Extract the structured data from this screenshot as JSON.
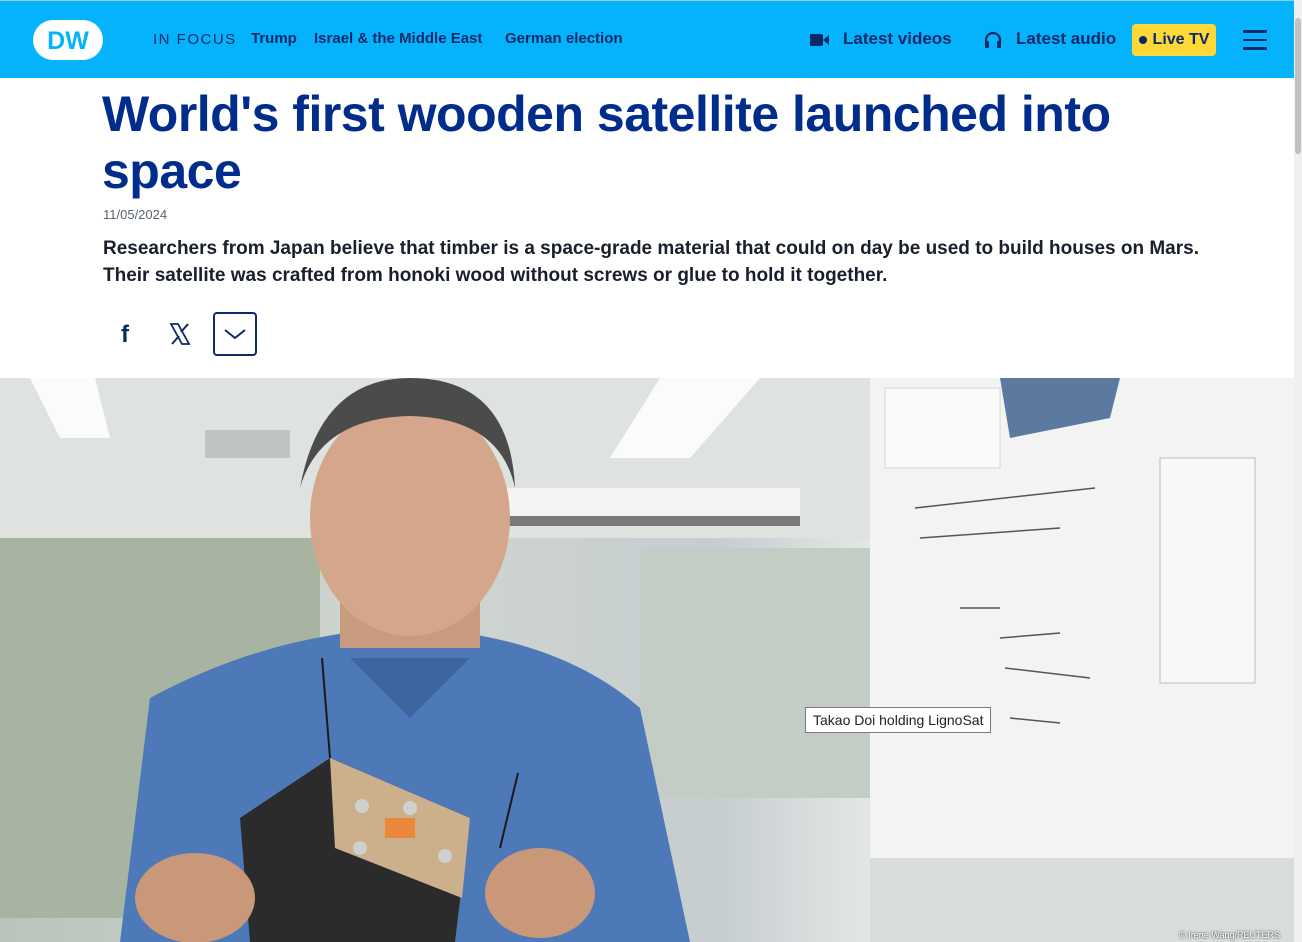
{
  "header": {
    "logo_text": "DW",
    "nav": {
      "in_focus": "IN FOCUS",
      "links": [
        "Trump",
        "Israel & the Middle East",
        "German election"
      ]
    },
    "latest_videos": "Latest videos",
    "latest_audio": "Latest audio",
    "live_tv": "Live TV",
    "icons": [
      "video-camera-icon",
      "headphones-icon",
      "hamburger-menu-icon"
    ],
    "colors": {
      "bar": "#05b2fc",
      "text": "#0b2a6a",
      "live_tv": "#fdd838"
    }
  },
  "article": {
    "title": "World's first wooden satellite launched into space",
    "date": "11/05/2024",
    "teaser": "Researchers from Japan believe that timber is a space-grade material that could on day be used to build houses on Mars. Their satellite was crafted from honoki wood without screws or glue to hold it together.",
    "share": [
      "facebook-icon",
      "x-icon",
      "chevron-down-icon"
    ],
    "title_color": "#002d8c"
  },
  "hero": {
    "tooltip": "Takao Doi holding LignoSat",
    "credit": "© Irene Wang/REUTERS"
  }
}
